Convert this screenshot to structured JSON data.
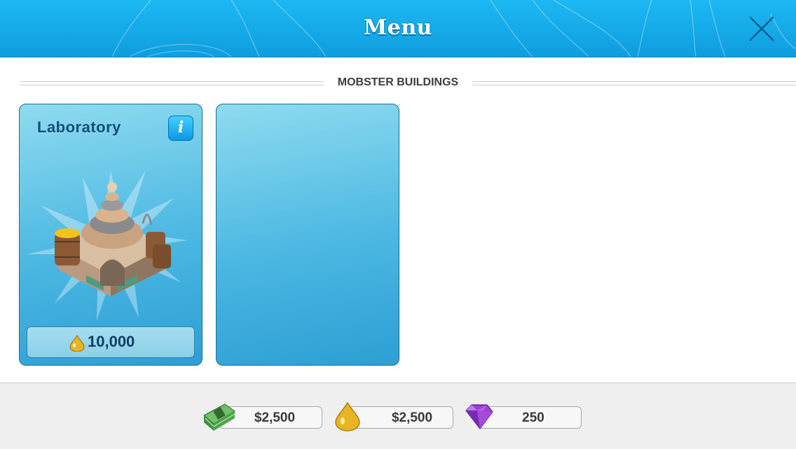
{
  "header": {
    "title": "Menu"
  },
  "section": {
    "title": "MOBSTER BUILDINGS"
  },
  "cards": [
    {
      "name": "Laboratory",
      "price": "10,000",
      "price_icon": "oil-drop-icon"
    }
  ],
  "footer": {
    "cash": {
      "value": "$2,500",
      "icon": "cash-stack-icon"
    },
    "oil": {
      "value": "$2,500",
      "icon": "oil-drop-icon"
    },
    "gems": {
      "value": "250",
      "icon": "gem-icon"
    }
  },
  "colors": {
    "header_blue": "#1cb8f2",
    "card_blue": "#4bb7e2",
    "oil_gold": "#e9b422",
    "gem_purple": "#9b3fd6"
  }
}
